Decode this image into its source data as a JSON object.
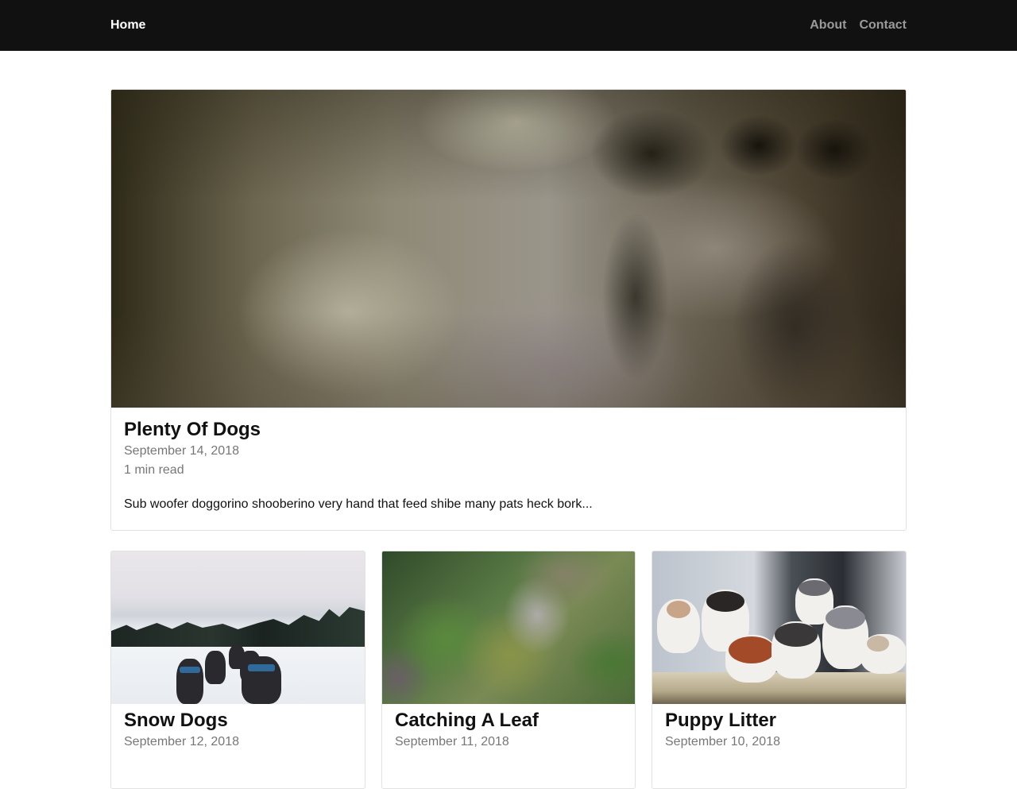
{
  "navbar": {
    "home": "Home",
    "links": [
      "About",
      "Contact"
    ]
  },
  "featured": {
    "title": "Plenty Of Dogs",
    "date": "September 14, 2018",
    "read_time": "1 min read",
    "excerpt": "Sub woofer doggorino shooberino very hand that feed shibe many pats heck bork..."
  },
  "posts": [
    {
      "title": "Snow Dogs",
      "date": "September 12, 2018",
      "read_time": ""
    },
    {
      "title": "Catching A Leaf",
      "date": "September 11, 2018",
      "read_time": ""
    },
    {
      "title": "Puppy Litter",
      "date": "September 10, 2018",
      "read_time": ""
    }
  ]
}
